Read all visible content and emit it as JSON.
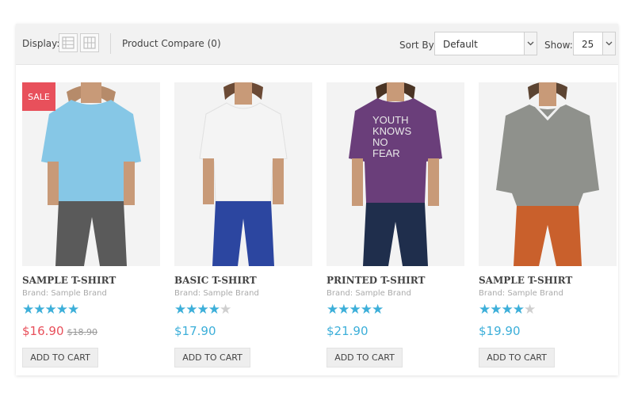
{
  "toolbar": {
    "display_label": "Display:",
    "compare_label": "Product Compare (0)",
    "sort_label": "Sort By:",
    "sort_value": "Default",
    "show_label": "Show:",
    "show_value": "25"
  },
  "products": [
    {
      "name": "SAMPLE T-SHIRT",
      "brand": "Brand: Sample Brand",
      "rating": 5,
      "price": "$16.90",
      "old_price": "$18.90",
      "sale_badge": "SALE",
      "cart_label": "ADD TO CART",
      "shirt_color": "#86c7e6"
    },
    {
      "name": "BASIC T-SHIRT",
      "brand": "Brand: Sample Brand",
      "rating": 4,
      "price": "$17.90",
      "cart_label": "ADD TO CART",
      "shirt_color": "#f4f4f4"
    },
    {
      "name": "PRINTED T-SHIRT",
      "brand": "Brand: Sample Brand",
      "rating": 5,
      "price": "$21.90",
      "cart_label": "ADD TO CART",
      "shirt_color": "#6a3e7a",
      "shirt_print": [
        "YOUTH",
        "KNOWS",
        "NO",
        "FEAR"
      ]
    },
    {
      "name": "SAMPLE T-SHIRT",
      "brand": "Brand: Sample Brand",
      "rating": 4,
      "price": "$19.90",
      "cart_label": "ADD TO CART",
      "shirt_color": "#8f918c"
    }
  ],
  "colors": {
    "accent": "#3dafd9",
    "sale": "#e8505b"
  }
}
